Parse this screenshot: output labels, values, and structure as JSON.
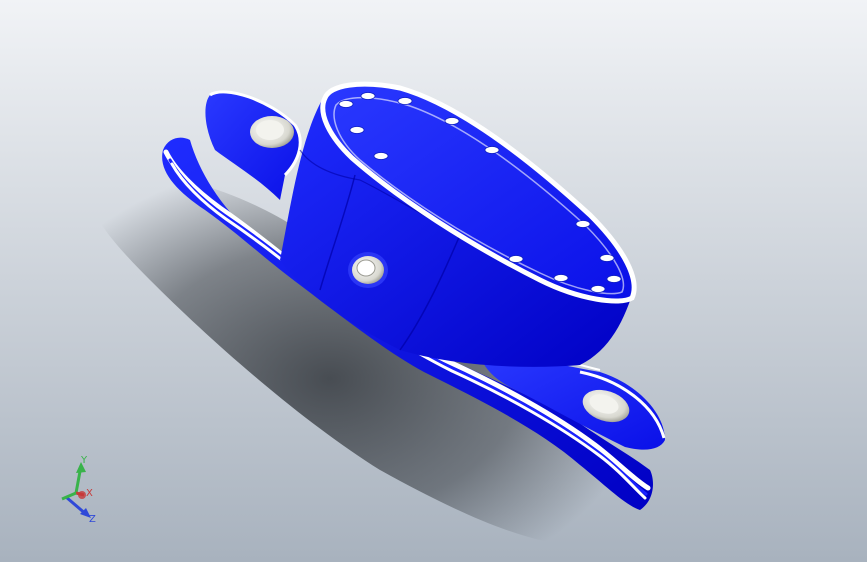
{
  "viewport": {
    "background_top": "#f1f3f6",
    "background_bottom": "#a8b2be"
  },
  "part": {
    "body_color": "#0f16f0",
    "body_dark": "#0000bf",
    "body_light": "#3543ff",
    "edge_color": "#ffffff",
    "shadow_color": "#23272c"
  },
  "triad": {
    "x_label": "X",
    "y_label": "Y",
    "z_label": "Z",
    "x_color": "#c73a3a",
    "y_color": "#39b34a",
    "z_color": "#2f49d8"
  }
}
